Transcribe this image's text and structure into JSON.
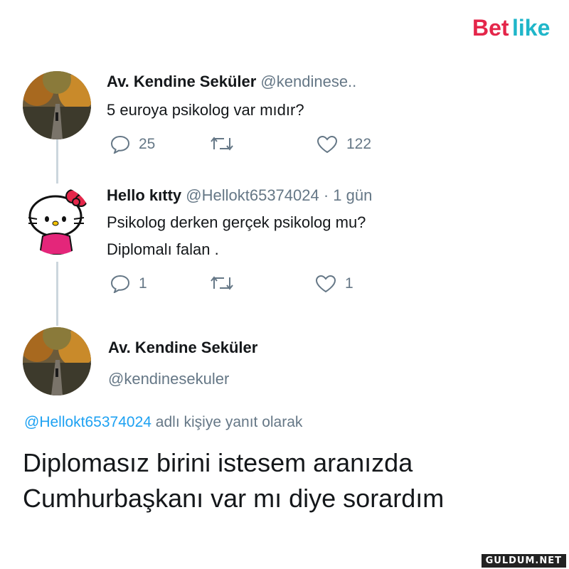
{
  "brand": {
    "logo_text": "Betlike"
  },
  "tweets": [
    {
      "author": "Av. Kendine Seküler",
      "handle": "@kendinese..",
      "time": "",
      "lines": [
        "5 euroya psikolog var mıdır?"
      ],
      "replies": "25",
      "retweets": "",
      "likes": "122"
    },
    {
      "author": "Hello kıtty",
      "handle": "@Hellokt65374024 · 1 gün",
      "lines": [
        "Psikolog derken gerçek psikolog mu?",
        "Diplomalı falan ."
      ],
      "replies": "1",
      "retweets": "",
      "likes": "1"
    }
  ],
  "focused": {
    "author": "Av. Kendine Seküler",
    "handle": "@kendinesekuler",
    "reply_mention": "@Hellokt65374024",
    "reply_suffix": "adlı kişiye yanıt olarak",
    "lines": [
      "Diplomasız birini istesem aranızda",
      "Cumhurbaşkanı var mı diye sorardım"
    ]
  },
  "watermark": "GULDUM.NET",
  "colors": {
    "brand_red": "#e4264a",
    "twitter_blue": "#1da1f2",
    "muted": "#657786"
  }
}
